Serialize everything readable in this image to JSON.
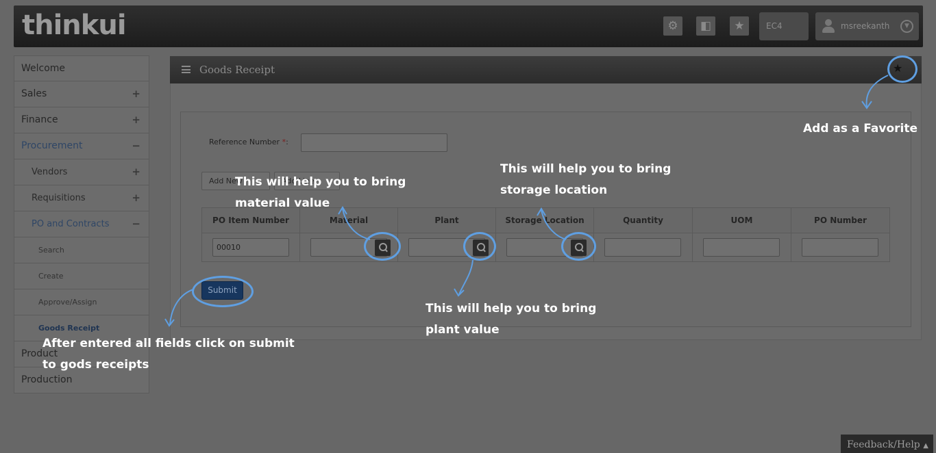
{
  "header": {
    "logo": "thinkui",
    "settings_icon": "gear-icon",
    "apps_icon": "apps-icon",
    "favorite_icon": "star-icon",
    "company_code": "EC4",
    "username": "msreekanth"
  },
  "sidebar": {
    "items": [
      {
        "label": "Welcome",
        "sign": ""
      },
      {
        "label": "Sales",
        "sign": "+"
      },
      {
        "label": "Finance",
        "sign": "+"
      },
      {
        "label": "Procurement",
        "sign": "−"
      },
      {
        "label": "Vendors",
        "sign": "+"
      },
      {
        "label": "Requisitions",
        "sign": "+"
      },
      {
        "label": "PO and Contracts",
        "sign": "−"
      },
      {
        "label": "Search",
        "sign": ""
      },
      {
        "label": "Create",
        "sign": ""
      },
      {
        "label": "Approve/Assign",
        "sign": ""
      },
      {
        "label": "Goods Receipt",
        "sign": ""
      },
      {
        "label": "Product",
        "sign": ""
      },
      {
        "label": "Production",
        "sign": ""
      }
    ]
  },
  "panel": {
    "title": "Goods Receipt",
    "reference_label": "Reference Number",
    "required_mark": "*",
    "reference_colon": ":",
    "reference_value": "",
    "add_new_label": "Add New",
    "add_line_label": "Add Line",
    "columns": [
      "PO Item Number",
      "Material",
      "Plant",
      "Storage Location",
      "Quantity",
      "UOM",
      "PO Number"
    ],
    "row": {
      "po_item_number": "00010",
      "material": "",
      "plant": "",
      "storage_location": "",
      "quantity": "",
      "uom": "",
      "po_number": ""
    },
    "submit_label": "Submit"
  },
  "feedback": {
    "label": "Feedback/Help"
  },
  "annotations": {
    "favorite": "Add as a Favorite",
    "storage_line1": "This will help   you to bring",
    "storage_line2": "storage location",
    "material_line1": "This will help   you to bring",
    "material_line2": "material value",
    "plant_line1": "This will help   you to bring",
    "plant_line2": "plant value",
    "submit_line1": "After entered all fields click on submit",
    "submit_line2": "to gods receipts"
  },
  "colors": {
    "overlay_background": "#676767",
    "annotation_ring": "#5f9fe2",
    "submit_button": "#17365e"
  }
}
